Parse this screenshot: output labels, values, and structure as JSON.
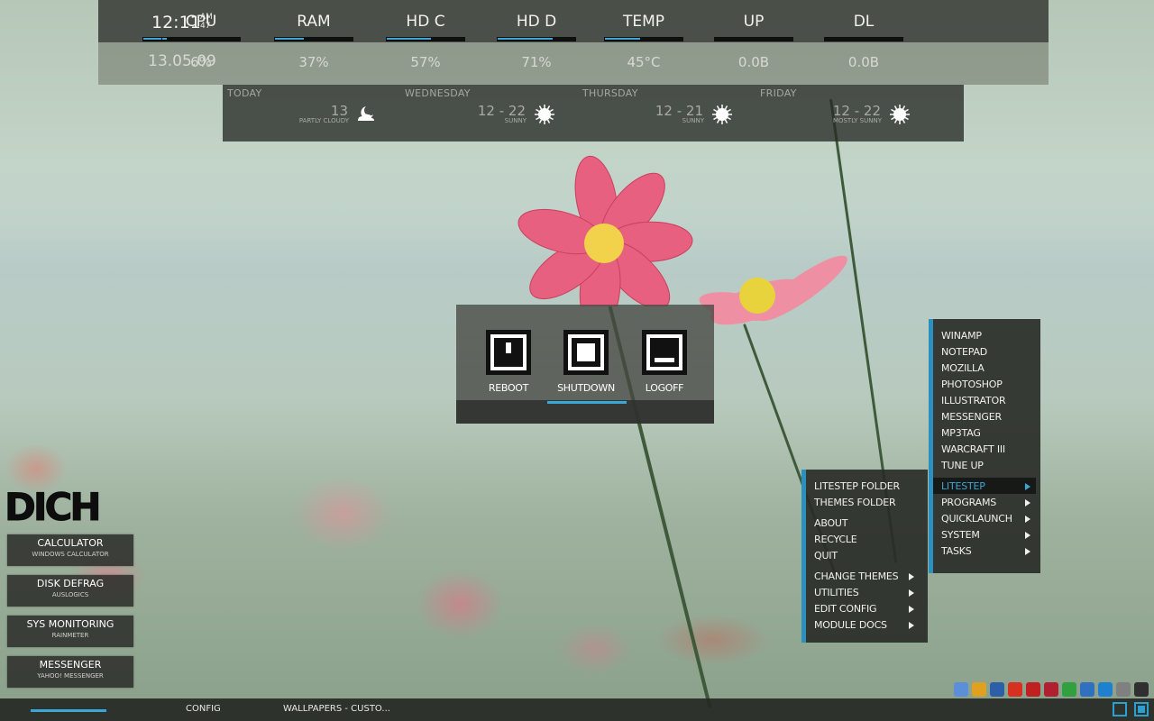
{
  "stats": {
    "clock": {
      "time": "12:11",
      "ampm": "AM",
      "seconds": "47",
      "date": "13.05.09"
    },
    "meters": [
      {
        "label": "CPU",
        "value": "6%",
        "fill": 0.06
      },
      {
        "label": "RAM",
        "value": "37%",
        "fill": 0.37
      },
      {
        "label": "HD C",
        "value": "57%",
        "fill": 0.57
      },
      {
        "label": "HD D",
        "value": "71%",
        "fill": 0.71
      },
      {
        "label": "TEMP",
        "value": "45°C",
        "fill": 0.45
      },
      {
        "label": "UP",
        "value": "0.0B",
        "fill": 0.0
      },
      {
        "label": "DL",
        "value": "0.0B",
        "fill": 0.0
      }
    ],
    "clock_fill": 0.8
  },
  "weather": [
    {
      "day": "TODAY",
      "temp": "13",
      "cond": "PARTLY CLOUDY",
      "icon": "partly-cloudy-night-icon"
    },
    {
      "day": "WEDNESDAY",
      "temp": "12 - 22",
      "cond": "SUNNY",
      "icon": "sun-icon"
    },
    {
      "day": "THURSDAY",
      "temp": "12 - 21",
      "cond": "SUNNY",
      "icon": "sun-icon"
    },
    {
      "day": "FRIDAY",
      "temp": "12 - 22",
      "cond": "MOSTLY SUNNY",
      "icon": "sun-icon"
    }
  ],
  "power": {
    "reboot": "REBOOT",
    "shutdown": "SHUTDOWN",
    "logoff": "LOGOFF"
  },
  "launcher": {
    "title": "DICH",
    "items": [
      {
        "title": "CALCULATOR",
        "sub": "WINDOWS CALCULATOR"
      },
      {
        "title": "DISK DEFRAG",
        "sub": "AUSLOGICS"
      },
      {
        "title": "SYS MONITORING",
        "sub": "RAINMETER"
      },
      {
        "title": "MESSENGER",
        "sub": "YAHOO! MESSENGER"
      }
    ]
  },
  "main_menu": {
    "items": [
      "LITESTEP FOLDER",
      "THEMES FOLDER",
      "ABOUT",
      "RECYCLE",
      "QUIT",
      "CHANGE THEMES",
      "UTILITIES",
      "EDIT CONFIG",
      "MODULE DOCS"
    ]
  },
  "sub_menu": {
    "items": [
      "WINAMP",
      "NOTEPAD",
      "MOZILLA",
      "PHOTOSHOP",
      "ILLUSTRATOR",
      "MESSENGER",
      "MP3TAG",
      "WARCRAFT III",
      "TUNE UP",
      "LITESTEP",
      "PROGRAMS",
      "QUICKLAUNCH",
      "SYSTEM",
      "TASKS"
    ],
    "highlighted": "LITESTEP"
  },
  "taskbar": {
    "config": "CONFIG",
    "wallpapers": "WALLPAPERS - CUSTO..."
  },
  "tray_icons": [
    "messenger-icon",
    "update-icon",
    "network-icon",
    "opera-icon",
    "close-app-icon",
    "antivirus-icon",
    "wifi-icon",
    "dialup-icon",
    "radio-icon",
    "usb-icon",
    "star-icon"
  ],
  "colors": {
    "accent": "#3ba7d6"
  }
}
